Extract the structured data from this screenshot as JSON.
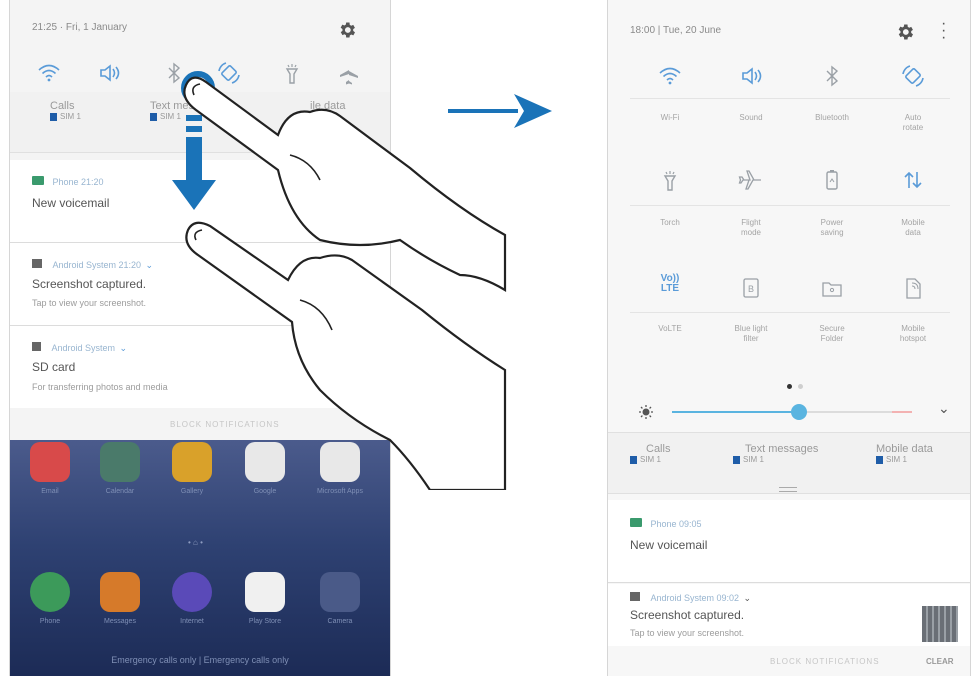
{
  "left": {
    "status_time": "21:25 · Fri, 1 January",
    "sims": [
      {
        "title": "Calls",
        "sub": "SIM 1"
      },
      {
        "title": "Text mes",
        "sub": "SIM 1"
      },
      {
        "title": "ile data",
        "sub": ""
      }
    ],
    "notifications": [
      {
        "app": "Phone  21:20",
        "title": "New voicemail",
        "sub": ""
      },
      {
        "app": "Android System  21:20",
        "title": "Screenshot captured.",
        "sub": "Tap to view your screenshot."
      },
      {
        "app": "Android System",
        "title": "SD card",
        "sub": "For transferring photos and media"
      }
    ],
    "block_label": "BLOCK NOTIFICATIONS",
    "apps_row1": [
      "Email",
      "Calendar",
      "Gallery",
      "Google",
      "Microsoft Apps"
    ],
    "apps_row2": [
      "Phone",
      "Messages",
      "Internet",
      "Play Store",
      "Camera"
    ],
    "emergency_text": "Emergency calls only | Emergency calls only"
  },
  "right": {
    "status_time": "18:00 | Tue, 20 June",
    "tiles": [
      {
        "label": "Wi-Fi",
        "icon": "wifi-icon"
      },
      {
        "label": "Sound",
        "icon": "sound-icon"
      },
      {
        "label": "Bluetooth",
        "icon": "bluetooth-icon"
      },
      {
        "label": "Auto\nrotate",
        "icon": "auto-rotate-icon"
      },
      {
        "label": "Torch",
        "icon": "torch-icon"
      },
      {
        "label": "Flight\nmode",
        "icon": "airplane-icon"
      },
      {
        "label": "Power\nsaving",
        "icon": "battery-icon"
      },
      {
        "label": "Mobile\ndata",
        "icon": "mobile-data-icon"
      },
      {
        "label": "VoLTE",
        "icon": "volte-icon"
      },
      {
        "label": "Blue light\nfilter",
        "icon": "blue-light-icon"
      },
      {
        "label": "Secure\nFolder",
        "icon": "secure-folder-icon"
      },
      {
        "label": "Mobile\nhotspot",
        "icon": "hotspot-icon"
      }
    ],
    "volte_text": "Vo))\nLTE",
    "brightness_level": 0.53,
    "sims": [
      {
        "title": "Calls",
        "sub": "SIM 1"
      },
      {
        "title": "Text messages",
        "sub": "SIM 1"
      },
      {
        "title": "Mobile data",
        "sub": "SIM 1"
      }
    ],
    "notifications": [
      {
        "app": "Phone  09:05",
        "title": "New voicemail",
        "sub": ""
      },
      {
        "app": "Android System  09:02",
        "title": "Screenshot captured.",
        "sub": "Tap to view your screenshot."
      }
    ],
    "block_label": "BLOCK NOTIFICATIONS",
    "clear_label": "CLEAR"
  },
  "colors": {
    "accent": "#5a9bd8",
    "arrow": "#1a73b8",
    "sim_badge": "#1f5da8"
  }
}
